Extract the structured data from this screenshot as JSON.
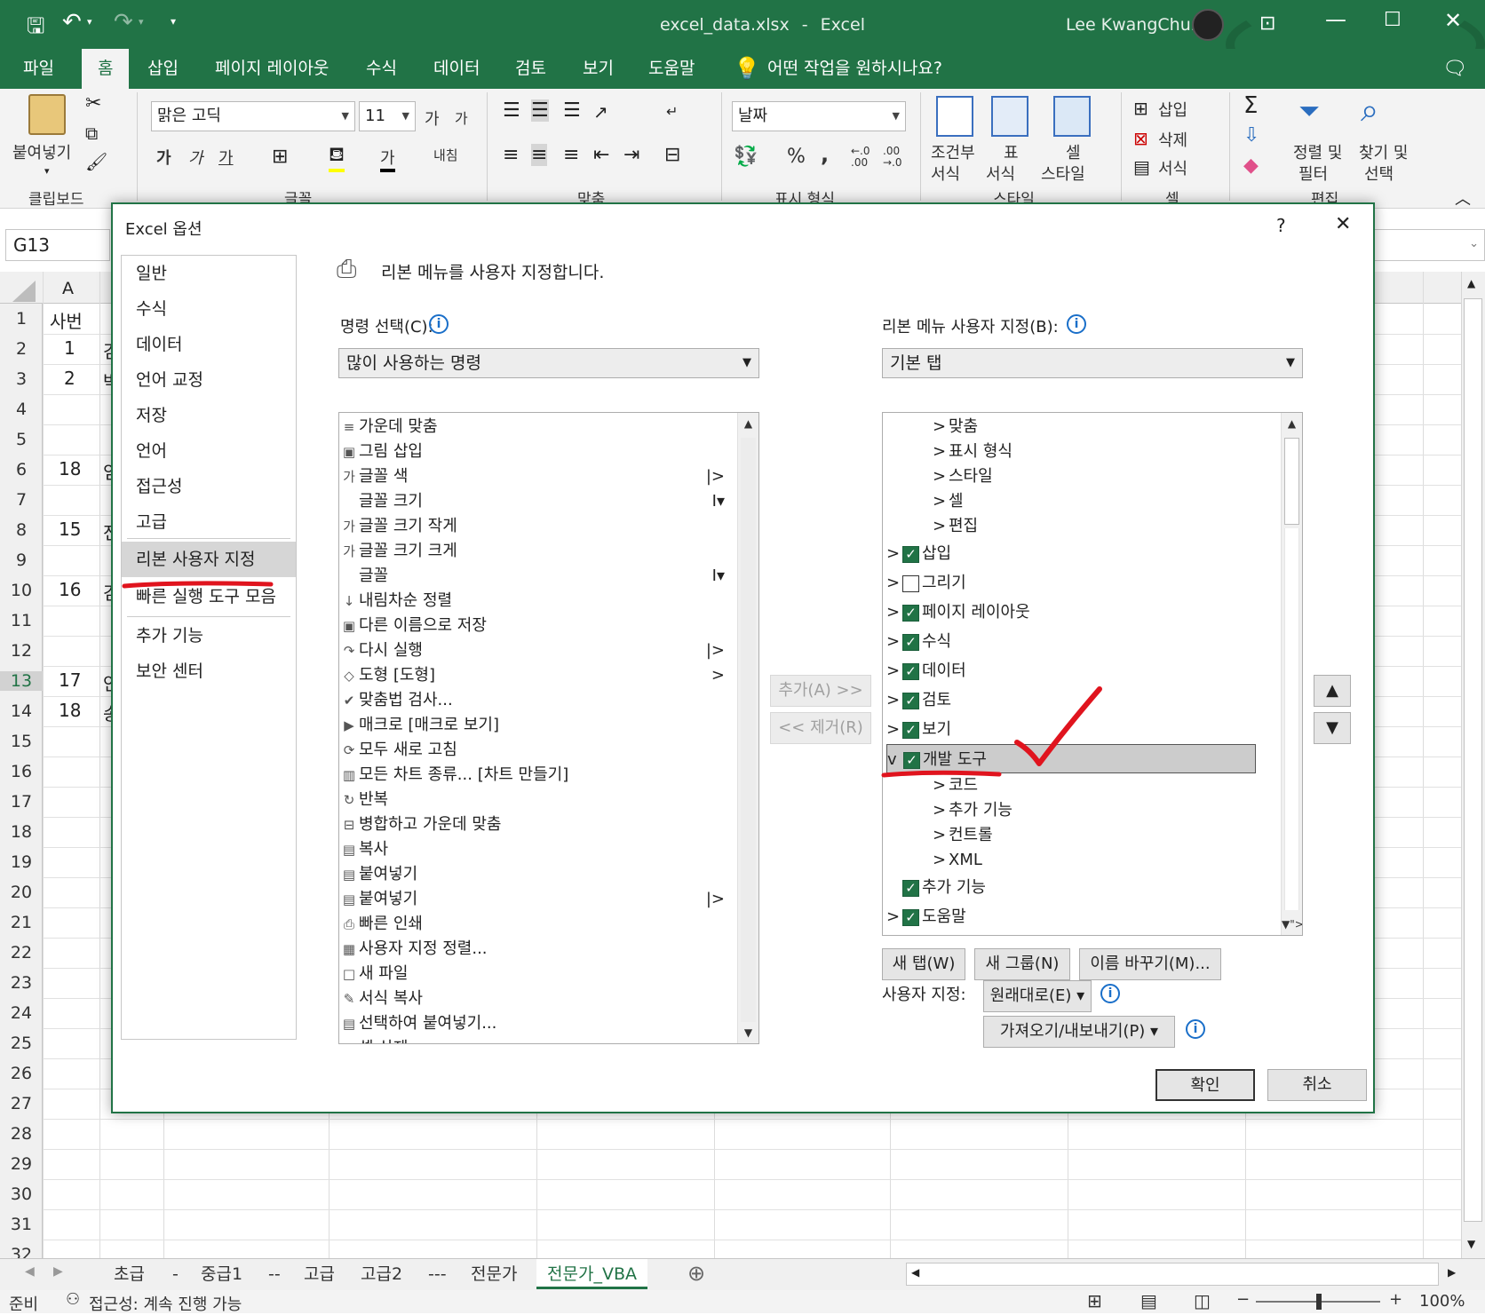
{
  "titlebar": {
    "filename": "excel_data.xlsx",
    "separator": "-",
    "app": "Excel",
    "user": "Lee KwangChun"
  },
  "ribbon_tabs": [
    "파일",
    "홈",
    "삽입",
    "페이지 레이아웃",
    "수식",
    "데이터",
    "검토",
    "보기",
    "도움말"
  ],
  "tell_me": "어떤 작업을 원하시나요?",
  "ribbon": {
    "paste": "붙여넣기",
    "font_name": "맑은 고딕",
    "font_size": "11",
    "grow_font": "가",
    "shrink_font": "가",
    "bold": "가",
    "italic": "가",
    "underline": "가",
    "font_color_char": "가",
    "wrap_text": "내침",
    "number_format": "날짜",
    "percent": "%",
    "comma": ",",
    "inc_decimal": "←.0 .00",
    "dec_decimal": ".00 →.0",
    "conditional": "조건부\n서식",
    "cond1": "조건부",
    "cond2": "서식",
    "table1": "표",
    "table2": "서식",
    "cell1": "셀",
    "cell2": "스타일",
    "insert": "삽입",
    "delete": "삭제",
    "format": "서식",
    "sort1": "정렬 및",
    "sort2": "필터",
    "find1": "찾기 및",
    "find2": "선택",
    "groups": [
      "클립보드",
      "글꼴",
      "맞춤",
      "표시 형식",
      "스타일",
      "셀",
      "편집"
    ]
  },
  "namebox": "G13",
  "columns": [
    "A"
  ],
  "rows": [
    "1",
    "2",
    "3",
    "4",
    "5",
    "6",
    "7",
    "8",
    "9",
    "10",
    "11",
    "12",
    "13",
    "14",
    "15",
    "16",
    "17",
    "18",
    "19",
    "20",
    "21",
    "22",
    "23",
    "24",
    "25",
    "26",
    "27",
    "28",
    "29",
    "30",
    "31",
    "32"
  ],
  "cells": {
    "a1": "사번",
    "a2": "1",
    "a3": "2",
    "a6": "18",
    "a8": "15",
    "a10": "16",
    "a13": "17",
    "a14": "18",
    "b2": "김",
    "b3": "박",
    "b6": "임",
    "b8": "전",
    "b10": "김",
    "b13": "안",
    "b14": "송"
  },
  "sheet_tabs": [
    "초급",
    "-",
    "중급1",
    "--",
    "고급",
    "고급2",
    "---",
    "전문가",
    "전문가_VBA"
  ],
  "status": {
    "ready": "준비",
    "accessibility": "접근성: 계속 진행 가능",
    "zoom": "100%"
  },
  "dialog": {
    "title": "Excel 옵션",
    "help": "?",
    "close": "✕",
    "nav": [
      "일반",
      "수식",
      "데이터",
      "언어 교정",
      "저장",
      "언어",
      "접근성",
      "고급",
      "리본 사용자 지정",
      "빠른 실행 도구 모음",
      "추가 기능",
      "보안 센터"
    ],
    "heading": "리본 메뉴를 사용자 지정합니다.",
    "choose_label": "명령 선택(C):",
    "choose_value": "많이 사용하는 명령",
    "customize_label": "리본 메뉴 사용자 지정(B):",
    "customize_value": "기본 탭",
    "commands": [
      {
        "icon": "≡",
        "text": "가운데 맞춤"
      },
      {
        "icon": "▣",
        "text": "그림 삽입"
      },
      {
        "icon": "가",
        "text": "글꼴 색",
        "right": "|>"
      },
      {
        "icon": "",
        "text": "글꼴 크기",
        "right": "I▾"
      },
      {
        "icon": "가",
        "text": "글꼴 크기 작게"
      },
      {
        "icon": "가",
        "text": "글꼴 크기 크게"
      },
      {
        "icon": "",
        "text": "글꼴",
        "right": "I▾"
      },
      {
        "icon": "↓",
        "text": "내림차순 정렬"
      },
      {
        "icon": "▣",
        "text": "다른 이름으로 저장"
      },
      {
        "icon": "↷",
        "text": "다시 실행",
        "right": "|>"
      },
      {
        "icon": "◇",
        "text": "도형 [도형]",
        "right": ">"
      },
      {
        "icon": "✔",
        "text": "맞춤법 검사..."
      },
      {
        "icon": "▶",
        "text": "매크로 [매크로 보기]"
      },
      {
        "icon": "⟳",
        "text": "모두 새로 고침"
      },
      {
        "icon": "▥",
        "text": "모든 차트 종류... [차트 만들기]"
      },
      {
        "icon": "↻",
        "text": "반복"
      },
      {
        "icon": "⊟",
        "text": "병합하고 가운데 맞춤"
      },
      {
        "icon": "▤",
        "text": "복사"
      },
      {
        "icon": "▤",
        "text": "붙여넣기"
      },
      {
        "icon": "▤",
        "text": "붙여넣기",
        "right": "|>"
      },
      {
        "icon": "⎙",
        "text": "빠른 인쇄"
      },
      {
        "icon": "▦",
        "text": "사용자 지정 정렬..."
      },
      {
        "icon": "□",
        "text": "새 파일"
      },
      {
        "icon": "✎",
        "text": "서식 복사"
      },
      {
        "icon": "▤",
        "text": "선택하여 붙여넣기..."
      },
      {
        "icon": "✕",
        "text": "셀 삭제"
      }
    ],
    "tree": [
      {
        "level": 2,
        "caret": ">",
        "text": "맞춤"
      },
      {
        "level": 2,
        "caret": ">",
        "text": "표시 형식"
      },
      {
        "level": 2,
        "caret": ">",
        "text": "스타일"
      },
      {
        "level": 2,
        "caret": ">",
        "text": "셀"
      },
      {
        "level": 2,
        "caret": ">",
        "text": "편집"
      },
      {
        "level": 1,
        "caret": ">",
        "check": true,
        "text": "삽입"
      },
      {
        "level": 1,
        "caret": ">",
        "check": false,
        "text": "그리기"
      },
      {
        "level": 1,
        "caret": ">",
        "check": true,
        "text": "페이지 레이아웃"
      },
      {
        "level": 1,
        "caret": ">",
        "check": true,
        "text": "수식"
      },
      {
        "level": 1,
        "caret": ">",
        "check": true,
        "text": "데이터"
      },
      {
        "level": 1,
        "caret": ">",
        "check": true,
        "text": "검토"
      },
      {
        "level": 1,
        "caret": ">",
        "check": true,
        "text": "보기"
      },
      {
        "level": 1,
        "caret": "v",
        "check": true,
        "text": "개발 도구",
        "selected": true
      },
      {
        "level": 2,
        "caret": ">",
        "text": "코드"
      },
      {
        "level": 2,
        "caret": ">",
        "text": "추가 기능"
      },
      {
        "level": 2,
        "caret": ">",
        "text": "컨트롤"
      },
      {
        "level": 2,
        "caret": ">",
        "text": "XML"
      },
      {
        "level": 1,
        "caret": "",
        "check": true,
        "text": "추가 기능"
      },
      {
        "level": 1,
        "caret": ">",
        "check": true,
        "text": "도움말"
      }
    ],
    "add_btn": "추가(A) >>",
    "remove_btn": "<< 제거(R)",
    "new_tab": "새 탭(W)",
    "new_group": "새 그룹(N)",
    "rename": "이름 바꾸기(M)...",
    "customize_text": "사용자 지정:",
    "reset": "원래대로(E) ▾",
    "import_export": "가져오기/내보내기(P) ▾",
    "ok": "확인",
    "cancel": "취소"
  },
  "colors": {
    "excel_green": "#217346",
    "annotation_red": "#e0141e"
  }
}
